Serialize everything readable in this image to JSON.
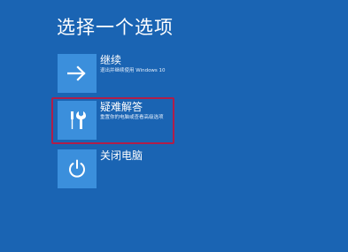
{
  "page": {
    "title": "选择一个选项",
    "background_color": "#1a64b3",
    "tile_color": "#3b8fdc",
    "highlight_color": "#b01e4a"
  },
  "options": [
    {
      "title": "继续",
      "description": "退出并继续使用 Windows 10",
      "icon": "arrow-right-icon"
    },
    {
      "title": "疑难解答",
      "description": "重置你的电脑或查看高级选项",
      "icon": "tools-icon",
      "highlighted": true
    },
    {
      "title": "关闭电脑",
      "description": "",
      "icon": "power-icon"
    }
  ]
}
